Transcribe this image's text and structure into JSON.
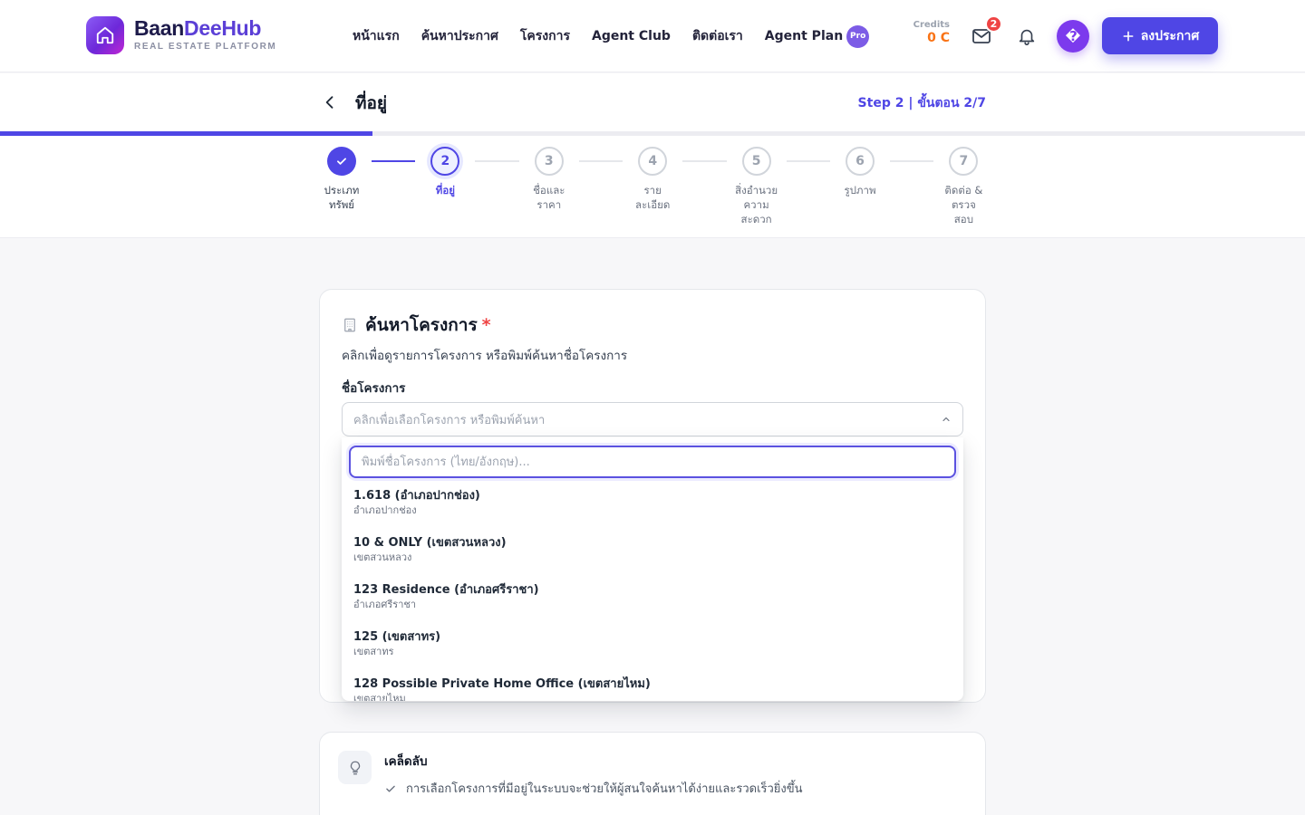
{
  "brand": {
    "name_part1": "Baan",
    "name_part2": "DeeHub",
    "tagline": "REAL ESTATE PLATFORM",
    "logo_icon": "house-icon",
    "accent_color": "#4f46e5"
  },
  "nav": {
    "items": [
      "หน้าแรก",
      "ค้นหาประกาศ",
      "โครงการ",
      "Agent Club",
      "ติดต่อเรา"
    ],
    "agent_plan_label": "Agent Plan",
    "pro_badge": "Pro"
  },
  "header": {
    "credits_label": "Credits",
    "credits_value": "0 C",
    "mail_icon": "mail-icon",
    "mail_badge": "2",
    "bell_icon": "bell-icon",
    "avatar_glyph": "�",
    "post_button_label": "ลงประกาศ"
  },
  "page": {
    "title": "ที่อยู่",
    "step_counter": "Step 2 | ขั้นตอน 2/7",
    "progress_fraction": 0.2857
  },
  "steps": [
    {
      "number": "1",
      "label": "ประเภท\nทรัพย์",
      "status": "done"
    },
    {
      "number": "2",
      "label": "ที่อยู่",
      "status": "current"
    },
    {
      "number": "3",
      "label": "ชื่อและ\nราคา",
      "status": "todo"
    },
    {
      "number": "4",
      "label": "ราย\nละเอียด",
      "status": "todo"
    },
    {
      "number": "5",
      "label": "สิ่งอำนวย\nความ\nสะดวก",
      "status": "todo"
    },
    {
      "number": "6",
      "label": "รูปภาพ",
      "status": "todo"
    },
    {
      "number": "7",
      "label": "ติดต่อ &\nตรวจ\nสอบ",
      "status": "todo"
    }
  ],
  "project_search": {
    "icon": "building-icon",
    "title": "ค้นหาโครงการ",
    "required_mark": "*",
    "description": "คลิกเพื่อดูรายการโครงการ หรือพิมพ์ค้นหาชื่อโครงการ",
    "field_label": "ชื่อโครงการ",
    "select_placeholder": "คลิกเพื่อเลือกโครงการ หรือพิมพ์ค้นหา",
    "search_placeholder": "พิมพ์ชื่อโครงการ (ไทย/อังกฤษ)...",
    "search_value": "",
    "options": [
      {
        "name": "1.618 (อำเภอปากช่อง)",
        "district": "อำเภอปากช่อง"
      },
      {
        "name": "10 & ONLY (เขตสวนหลวง)",
        "district": "เขตสวนหลวง"
      },
      {
        "name": "123 Residence (อำเภอศรีราชา)",
        "district": "อำเภอศรีราชา"
      },
      {
        "name": "125 (เขตสาทร)",
        "district": "เขตสาทร"
      },
      {
        "name": "128 Possible Private Home Office (เขตสายไหม)",
        "district": "เขตสายไหม"
      }
    ]
  },
  "tips": {
    "icon": "lightbulb-icon",
    "title": "เคล็ดลับ",
    "items": [
      "การเลือกโครงการที่มีอยู่ในระบบจะช่วยให้ผู้สนใจค้นหาได้ง่ายและรวดเร็วยิ่งขึ้น"
    ]
  }
}
